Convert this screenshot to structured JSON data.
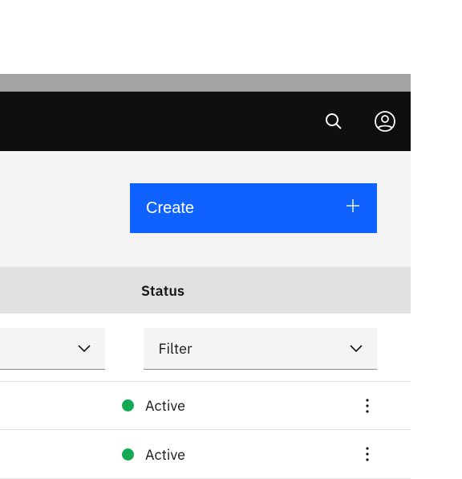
{
  "header": {
    "search_icon": "search",
    "user_icon": "user"
  },
  "toolbar": {
    "create_label": "Create"
  },
  "columns": {
    "status": "Status"
  },
  "filters": {
    "narrow_label": "",
    "wide_label": "Filter"
  },
  "rows": [
    {
      "status_label": "Active",
      "status_color": "green"
    },
    {
      "status_label": "Active",
      "status_color": "green"
    }
  ]
}
